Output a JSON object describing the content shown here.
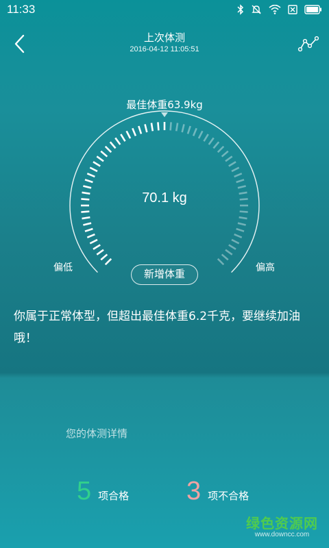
{
  "status_bar": {
    "time": "11:33",
    "icons": [
      "bluetooth-icon",
      "mute-icon",
      "wifi-icon",
      "sim-off-icon",
      "battery-icon"
    ]
  },
  "header": {
    "title": "上次体测",
    "datetime": "2016-04-12 11:05:51",
    "back_icon": "chevron-left-icon",
    "trend_icon": "trend-line-icon"
  },
  "gauge": {
    "best_weight_label": "最佳体重63.9kg",
    "current_weight": "70.1 kg",
    "low_label": "偏低",
    "high_label": "偏高",
    "add_button_label": "新增体重",
    "fill_fraction": 0.5
  },
  "summary_text": "你属于正常体型，但超出最佳体重6.2千克，要继续加油哦！",
  "details": {
    "title": "您的体测详情",
    "pass_count": "5",
    "pass_label": "项合格",
    "fail_count": "3",
    "fail_label": "项不合格"
  },
  "watermark": {
    "main": "绿色资源网",
    "sub": "www.downcc.com"
  },
  "colors": {
    "pass": "#31d08c",
    "fail": "#f2a3a3",
    "background_top": "#0b9199",
    "background_bottom": "#1aa0ae"
  }
}
